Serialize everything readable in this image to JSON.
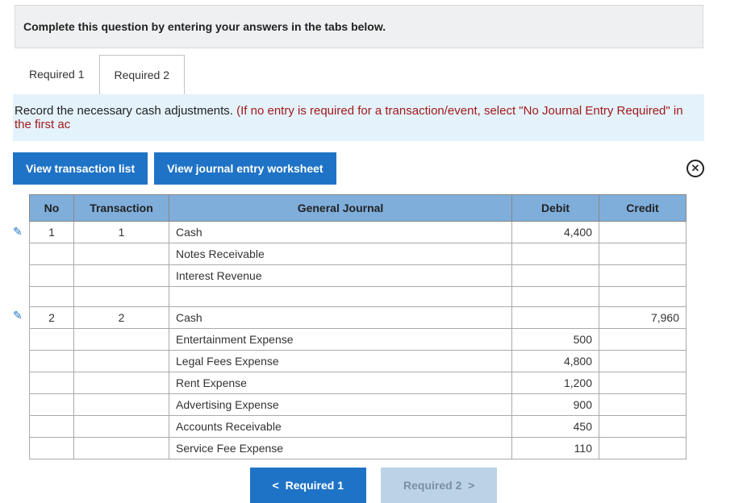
{
  "instruction": "Complete this question by entering your answers in the tabs below.",
  "tabs": {
    "t1": "Required 1",
    "t2": "Required 2"
  },
  "hint": {
    "black": "Record the necessary cash adjustments. ",
    "red": "(If no entry is required for a transaction/event, select \"No Journal Entry Required\" in the first ac"
  },
  "actions": {
    "view_list": "View transaction list",
    "view_worksheet": "View journal entry worksheet"
  },
  "columns": {
    "no": "No",
    "trans": "Transaction",
    "gj": "General Journal",
    "debit": "Debit",
    "credit": "Credit"
  },
  "rows": [
    {
      "no": "1",
      "trans": "1",
      "gj": "Cash",
      "debit": "4,400",
      "credit": "",
      "edit": true
    },
    {
      "no": "",
      "trans": "",
      "gj": "Notes Receivable",
      "debit": "",
      "credit": ""
    },
    {
      "no": "",
      "trans": "",
      "gj": "Interest Revenue",
      "debit": "",
      "credit": ""
    },
    {
      "no": "",
      "trans": "",
      "gj": "",
      "debit": "",
      "credit": ""
    },
    {
      "no": "2",
      "trans": "2",
      "gj": " Cash",
      "debit": "",
      "credit": "7,960",
      "edit": true
    },
    {
      "no": "",
      "trans": "",
      "gj": "Entertainment Expense",
      "debit": "500",
      "credit": ""
    },
    {
      "no": "",
      "trans": "",
      "gj": "Legal Fees Expense",
      "debit": "4,800",
      "credit": ""
    },
    {
      "no": "",
      "trans": "",
      "gj": "Rent Expense",
      "debit": "1,200",
      "credit": ""
    },
    {
      "no": "",
      "trans": "",
      "gj": "Advertising Expense",
      "debit": "900",
      "credit": ""
    },
    {
      "no": "",
      "trans": "",
      "gj": "Accounts Receivable",
      "debit": "450",
      "credit": ""
    },
    {
      "no": "",
      "trans": "",
      "gj": "Service Fee Expense",
      "debit": "110",
      "credit": ""
    }
  ],
  "nav": {
    "prev": "Required 1",
    "next": "Required 2"
  }
}
